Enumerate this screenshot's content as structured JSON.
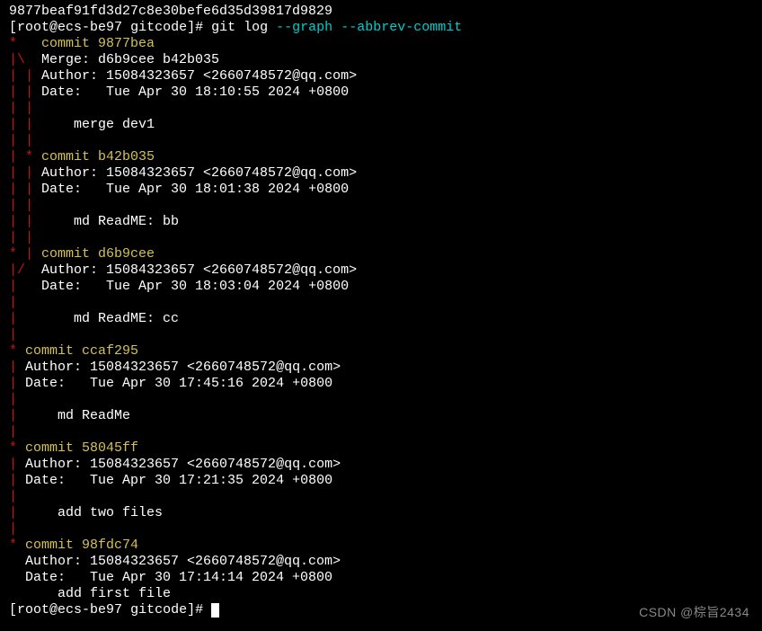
{
  "partial_hash": "9877beaf91fd3d27c8e30befe6d35d39817d9829",
  "prompt": {
    "user": "root",
    "host": "ecs-be97",
    "cwd": "gitcode",
    "symbol": "#"
  },
  "command": {
    "base": "git log",
    "flag1": "--graph",
    "flag2": "--abbrev-commit"
  },
  "commits": [
    {
      "graph_prefix": "*   ",
      "hash": "9877bea",
      "merge_line": "|\\  Merge: d6b9cee b42b035",
      "author_line": "| | Author: 15084323657 <2660748572@qq.com>",
      "date_line": "| | Date:   Tue Apr 30 18:10:55 2024 +0800",
      "blank1": "| |",
      "msg_line": "| |     merge dev1",
      "blank2": "| |"
    },
    {
      "graph_prefix": "| * ",
      "hash": "b42b035",
      "author_line": "| | Author: 15084323657 <2660748572@qq.com>",
      "date_line": "| | Date:   Tue Apr 30 18:01:38 2024 +0800",
      "blank1": "| |",
      "msg_line": "| |     md ReadME: bb",
      "blank2": "| |"
    },
    {
      "graph_prefix": "* | ",
      "hash": "d6b9cee",
      "author_line": "|/  Author: 15084323657 <2660748572@qq.com>",
      "date_line": "|   Date:   Tue Apr 30 18:03:04 2024 +0800",
      "blank1": "|",
      "msg_line": "|       md ReadME: cc",
      "blank2": "|"
    },
    {
      "graph_prefix": "* ",
      "hash": "ccaf295",
      "author_line": "| Author: 15084323657 <2660748572@qq.com>",
      "date_line": "| Date:   Tue Apr 30 17:45:16 2024 +0800",
      "blank1": "|",
      "msg_line": "|     md ReadMe",
      "blank2": "|"
    },
    {
      "graph_prefix": "* ",
      "hash": "58045ff",
      "author_line": "| Author: 15084323657 <2660748572@qq.com>",
      "date_line": "| Date:   Tue Apr 30 17:21:35 2024 +0800",
      "blank1": "|",
      "msg_line": "|     add two files",
      "blank2": "|"
    },
    {
      "graph_prefix": "* ",
      "hash": "98fdc74",
      "author_line": "  Author: 15084323657 <2660748572@qq.com>",
      "date_line": "  Date:   Tue Apr 30 17:14:14 2024 +0800",
      "blank1": "",
      "msg_line": "      add first file"
    }
  ],
  "watermark": "CSDN @棕旨2434"
}
